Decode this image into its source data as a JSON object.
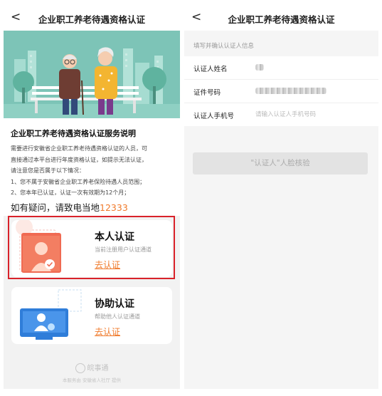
{
  "left": {
    "nav": {
      "back": "<",
      "title": "企业职工养老待遇资格认证"
    },
    "info": {
      "title": "企业职工养老待遇资格认证服务说明",
      "lines": [
        "需要进行安徽省企业职工养老待遇资格认证的人员，可",
        "直接通过本平台进行年度资格认证，如提示无法认证，",
        "请注意您是否属于以下情况：",
        "1、您不属于安徽省企业职工养老保险待遇人员范围；",
        "2、您本年已认证，认证一次有效期为12个月；"
      ],
      "hotline_prefix": "如有疑问，请致电当地",
      "hotline_number": "12333"
    },
    "cards": [
      {
        "title": "本人认证",
        "subtitle": "当前注册用户认证通道",
        "link": "去认证"
      },
      {
        "title": "协助认证",
        "subtitle": "帮助他人认证通道",
        "link": "去认证"
      }
    ],
    "footer": {
      "brand": "皖事通",
      "note": "本服务由 安徽省人社厅 提供"
    },
    "colors": {
      "accent": "#f07a2b",
      "hero_bg": "#7dc4b7",
      "highlight": "#d9222a"
    }
  },
  "right": {
    "nav": {
      "back": "<",
      "title": "企业职工养老待遇资格认证"
    },
    "hint": "填写并确认认证人信息",
    "fields": [
      {
        "label": "认证人姓名"
      },
      {
        "label": "证件号码"
      },
      {
        "label": "认证人手机号",
        "placeholder": "请输入认证人手机号码"
      }
    ],
    "button": "\"认证人\"人脸核验"
  }
}
